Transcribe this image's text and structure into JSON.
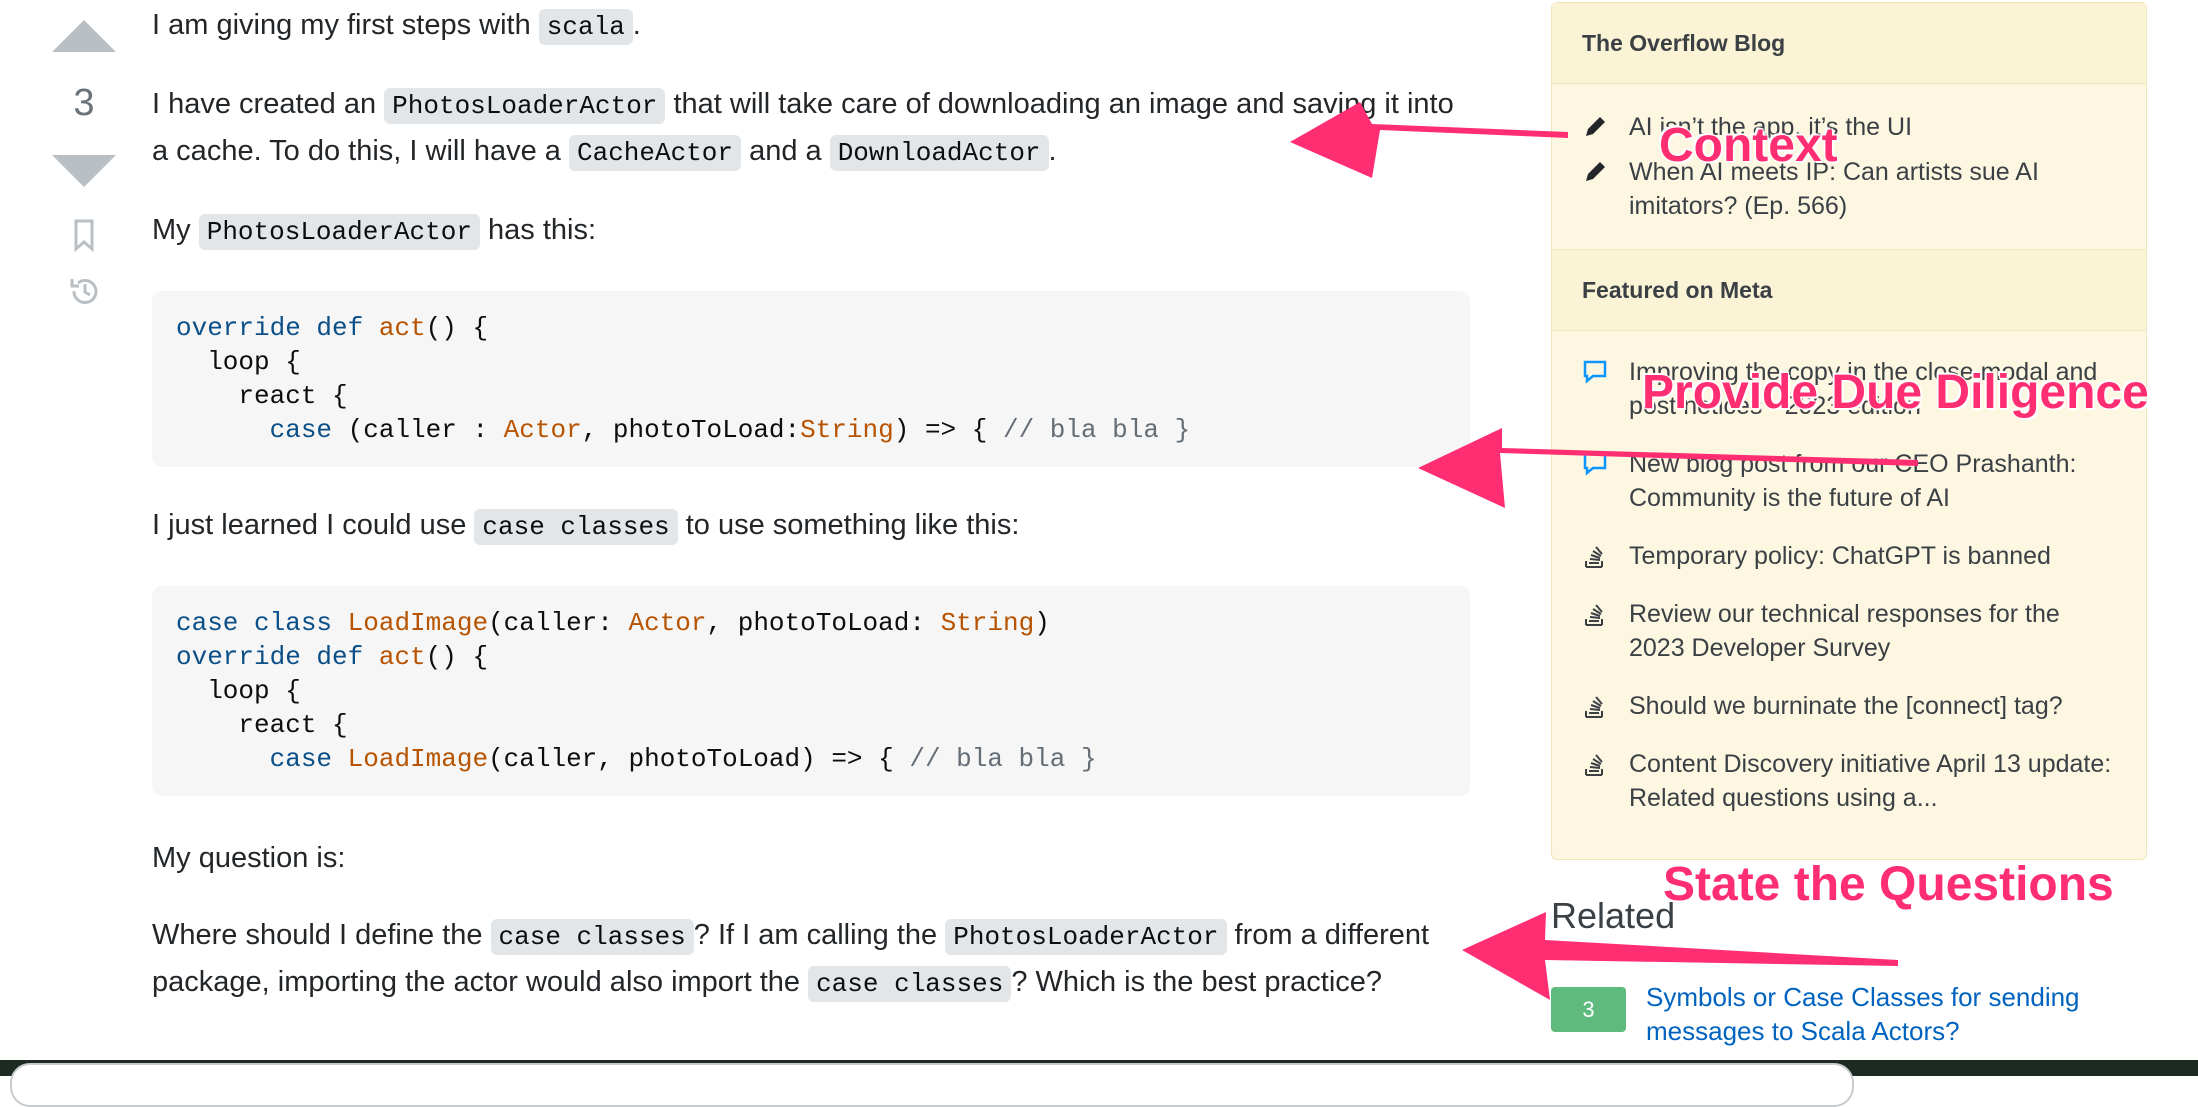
{
  "vote": {
    "count": "3"
  },
  "post": {
    "p1": {
      "a": "I am giving my first steps with ",
      "code": "scala",
      "b": "."
    },
    "p2": {
      "a": "I have created an ",
      "code1": "PhotosLoaderActor",
      "b": " that will take care of downloading an image and saving it into a cache. To do this, I will have a ",
      "code2": "CacheActor",
      "c": " and a ",
      "code3": "DownloadActor",
      "d": "."
    },
    "p3": {
      "a": "My ",
      "code": "PhotosLoaderActor",
      "b": " has this:"
    },
    "code1": {
      "l1a": "override def",
      "l1b": "act",
      "l1c": "() {",
      "l2": "  loop {",
      "l3": "    react {",
      "l4a": "      case",
      "l4b": " (caller : ",
      "l4c": "Actor",
      "l4d": ", photoToLoad:",
      "l4e": "String",
      "l4f": ") => { ",
      "l4g": "// bla bla }"
    },
    "p4": {
      "a": "I just learned I could use ",
      "code": "case classes",
      "b": " to use something like this:"
    },
    "code2": {
      "l1a": "case class",
      "l1b": " LoadImage",
      "l1c": "(caller: ",
      "l1d": "Actor",
      "l1e": ", photoToLoad: ",
      "l1f": "String",
      "l1g": ")",
      "l2a": "override def",
      "l2b": " act",
      "l2c": "() {",
      "l3": "  loop {",
      "l4": "    react {",
      "l5a": "      case",
      "l5b": " LoadImage",
      "l5c": "(caller, photoToLoad) => { ",
      "l5d": "// bla bla }"
    },
    "p5": "My question is:",
    "p6": {
      "a": "Where should I define the ",
      "code1": "case classes",
      "b": "? If I am calling the ",
      "code2": "PhotosLoaderActor",
      "c": " from a different package, importing the actor would also import the ",
      "code3": "case classes",
      "d": "? Which is the best practice?"
    }
  },
  "sidebar": {
    "blog_title": "The Overflow Blog",
    "blog_items": [
      {
        "icon": "pencil-icon",
        "text": "AI isn’t the app, it’s the UI"
      },
      {
        "icon": "pencil-icon",
        "text": "When AI meets IP: Can artists sue AI imitators? (Ep. 566)"
      }
    ],
    "meta_title": "Featured on Meta",
    "meta_items": [
      {
        "icon": "chat-bubble-icon",
        "text": "Improving the copy in the close modal and post notices - 2023 edition"
      },
      {
        "icon": "chat-bubble-icon",
        "text": "New blog post from our CEO Prashanth: Community is the future of AI"
      },
      {
        "icon": "stack-icon",
        "text": "Temporary policy: ChatGPT is banned"
      },
      {
        "icon": "stack-icon",
        "text": "Review our technical responses for the 2023 Developer Survey"
      },
      {
        "icon": "stack-icon",
        "text": "Should we burninate the [connect] tag?"
      },
      {
        "icon": "stack-icon",
        "text": "Content Discovery initiative April 13 update: Related questions using a..."
      }
    ]
  },
  "related": {
    "title": "Related",
    "items": [
      {
        "score": "3",
        "title": "Symbols or Case Classes for sending messages to Scala Actors?"
      }
    ]
  },
  "annotations": {
    "context": "Context",
    "due_diligence": "Provide Due Diligence",
    "questions": "State the Questions",
    "color": "#ff2e73"
  }
}
